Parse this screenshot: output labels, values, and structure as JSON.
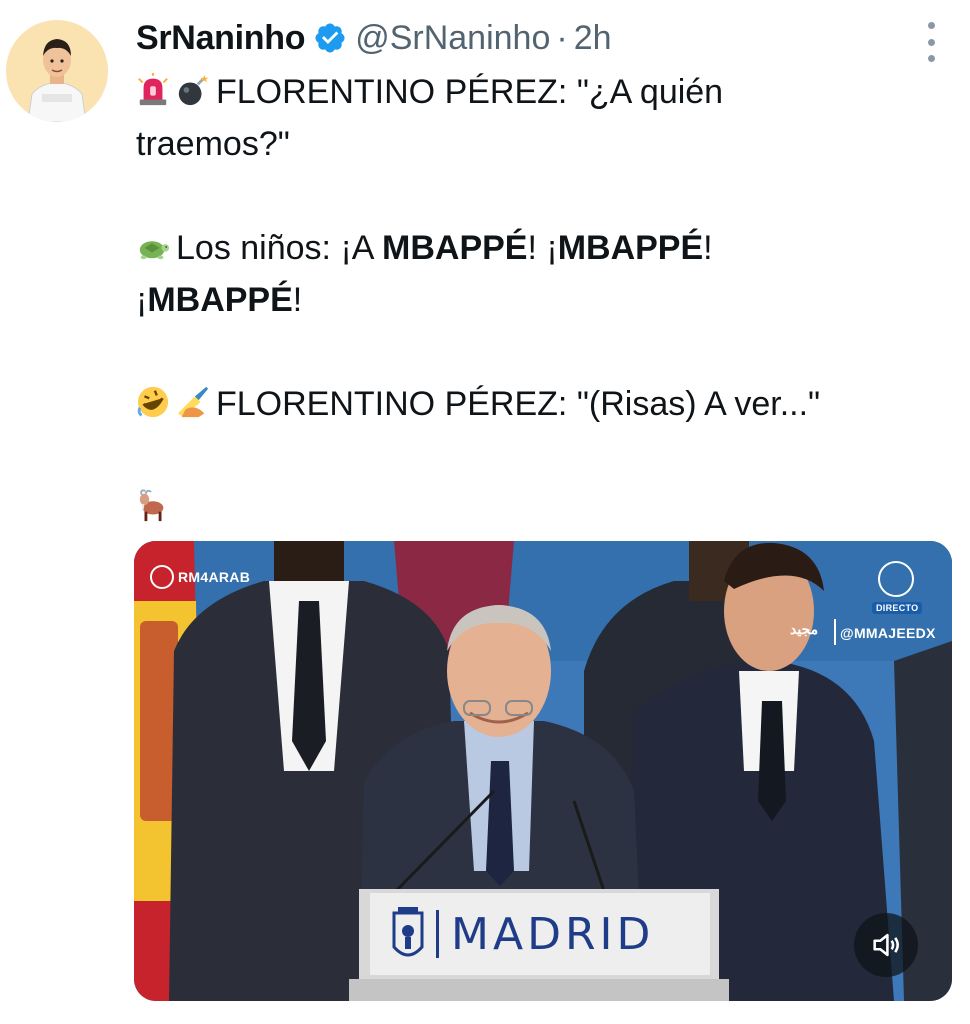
{
  "author": {
    "display_name": "SrNaninho",
    "handle": "@SrNaninho",
    "separator": "·",
    "time": "2h",
    "verified": true
  },
  "tweet": {
    "line1_text": "FLORENTINO PÉREZ: \"¿A quién",
    "line2_text": "traemos?\"",
    "line3_prefix": "Los niños: ¡A ",
    "line3_bold1": "MBAPPÉ",
    "line3_mid": "! ¡",
    "line3_bold2": "MBAPPÉ",
    "line3_end": "!",
    "line4_prefix": "¡",
    "line4_bold": "MBAPPÉ",
    "line4_end": "!",
    "line5_text": "FLORENTINO PÉREZ: \"(Risas) A ver...\"",
    "emojis": [
      "siren-emoji",
      "bomb-emoji",
      "turtle-emoji",
      "rolling-laughing-emoji",
      "writing-hand-emoji",
      "goat-emoji"
    ]
  },
  "media": {
    "watermark_left": "RM4ARAB",
    "watermark_right": "@MMAJEEDX",
    "watermark_arabic": "مجيد",
    "watermark_live": "DIRECTO",
    "podium_text": "MADRID"
  },
  "colors": {
    "text": "#0f1419",
    "secondary": "#536471",
    "verified": "#1d9bf0",
    "podium_blue": "#1f3c88"
  }
}
